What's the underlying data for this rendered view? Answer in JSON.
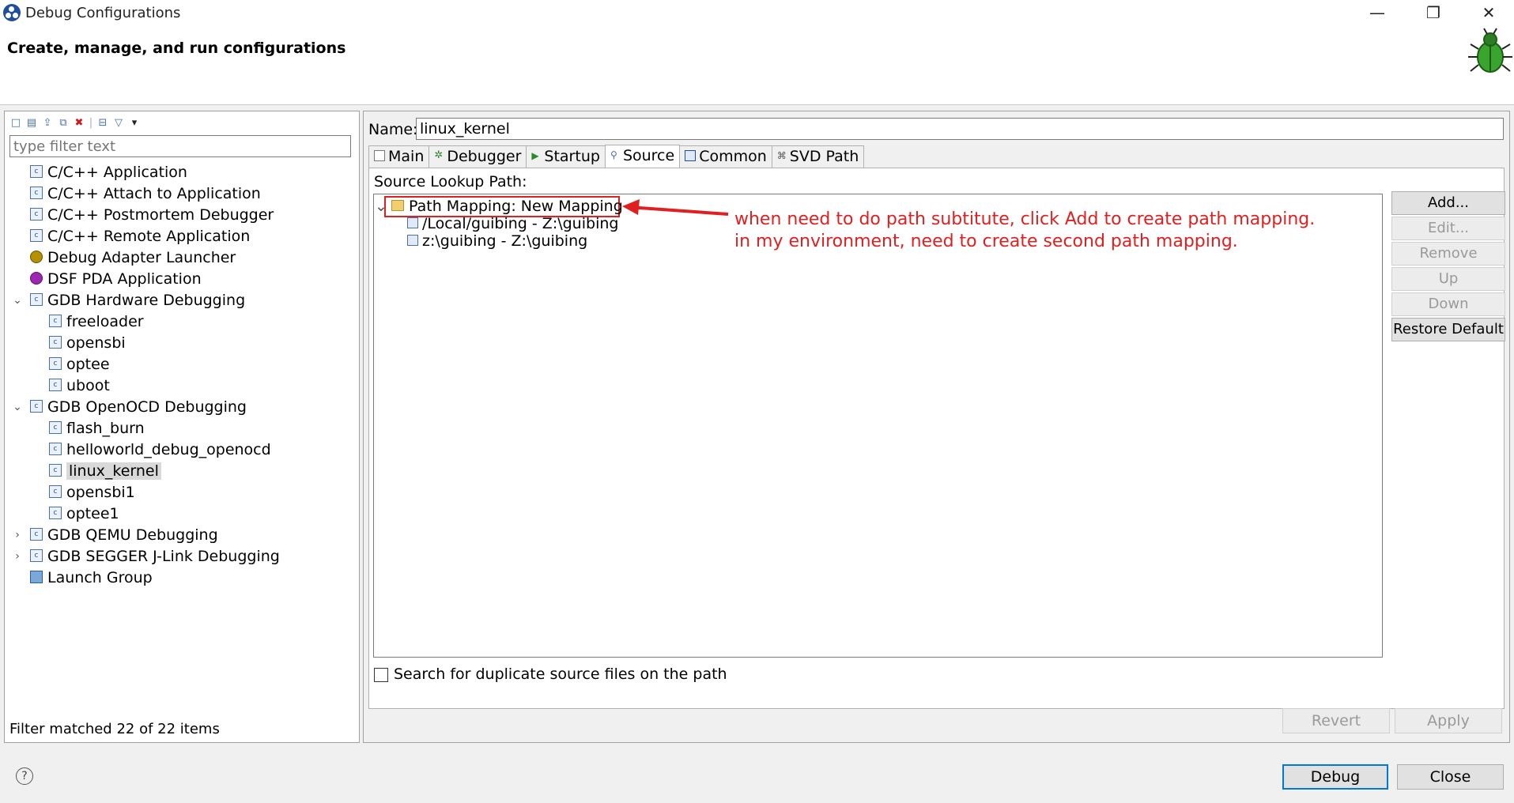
{
  "window": {
    "title": "Debug Configurations",
    "minimize": "—",
    "restore": "❐",
    "close": "✕"
  },
  "header": {
    "title": "Create, manage, and run configurations"
  },
  "left": {
    "filter_placeholder": "type filter text",
    "toolbar": [
      "new-config-icon",
      "new-prototype-icon",
      "export-icon",
      "duplicate-icon",
      "delete-icon",
      "collapse-all-icon",
      "filter-icon",
      "view-menu-icon"
    ],
    "tree": [
      {
        "label": "C/C++ Application",
        "level": 0,
        "arrow": "",
        "icon": "c"
      },
      {
        "label": "C/C++ Attach to Application",
        "level": 0,
        "arrow": "",
        "icon": "c"
      },
      {
        "label": "C/C++ Postmortem Debugger",
        "level": 0,
        "arrow": "",
        "icon": "c"
      },
      {
        "label": "C/C++ Remote Application",
        "level": 0,
        "arrow": "",
        "icon": "c"
      },
      {
        "label": "Debug Adapter Launcher",
        "level": 0,
        "arrow": "",
        "icon": "gear"
      },
      {
        "label": "DSF PDA Application",
        "level": 0,
        "arrow": "",
        "icon": "pda"
      },
      {
        "label": "GDB Hardware Debugging",
        "level": 0,
        "arrow": "expanded",
        "icon": "c"
      },
      {
        "label": "freeloader",
        "level": 1,
        "arrow": "",
        "icon": "c"
      },
      {
        "label": "opensbi",
        "level": 1,
        "arrow": "",
        "icon": "c"
      },
      {
        "label": "optee",
        "level": 1,
        "arrow": "",
        "icon": "c"
      },
      {
        "label": "uboot",
        "level": 1,
        "arrow": "",
        "icon": "c"
      },
      {
        "label": "GDB OpenOCD Debugging",
        "level": 0,
        "arrow": "expanded",
        "icon": "c"
      },
      {
        "label": "flash_burn",
        "level": 1,
        "arrow": "",
        "icon": "c"
      },
      {
        "label": "helloworld_debug_openocd",
        "level": 1,
        "arrow": "",
        "icon": "c"
      },
      {
        "label": "linux_kernel",
        "level": 1,
        "arrow": "",
        "icon": "c",
        "selected": true
      },
      {
        "label": "opensbi1",
        "level": 1,
        "arrow": "",
        "icon": "c"
      },
      {
        "label": "optee1",
        "level": 1,
        "arrow": "",
        "icon": "c"
      },
      {
        "label": "GDB QEMU Debugging",
        "level": 0,
        "arrow": "collapsed",
        "icon": "c"
      },
      {
        "label": "GDB SEGGER J-Link Debugging",
        "level": 0,
        "arrow": "collapsed",
        "icon": "c"
      },
      {
        "label": "Launch Group",
        "level": 0,
        "arrow": "",
        "icon": "launch"
      }
    ],
    "status": "Filter matched 22 of 22 items"
  },
  "right": {
    "name_label": "Name:",
    "name_value": "linux_kernel",
    "tabs": [
      {
        "label": "Main",
        "active": false
      },
      {
        "label": "Debugger",
        "active": false
      },
      {
        "label": "Startup",
        "active": false
      },
      {
        "label": "Source",
        "active": true
      },
      {
        "label": "Common",
        "active": false
      },
      {
        "label": "SVD Path",
        "active": false
      }
    ],
    "source_lookup_label": "Source Lookup Path:",
    "source_tree": {
      "root": "Path Mapping: New Mapping",
      "children": [
        "/Local/guibing - Z:\\guibing",
        "z:\\guibing - Z:\\guibing"
      ]
    },
    "annotation": [
      "when need to do path subtitute, click Add to create path mapping.",
      "in my environment, need to create second path mapping."
    ],
    "side_buttons": [
      {
        "label": "Add...",
        "enabled": true
      },
      {
        "label": "Edit...",
        "enabled": false
      },
      {
        "label": "Remove",
        "enabled": false
      },
      {
        "label": "Up",
        "enabled": false
      },
      {
        "label": "Down",
        "enabled": false
      },
      {
        "label": "Restore Default",
        "enabled": true
      }
    ],
    "duplicate_checkbox_label": "Search for duplicate source files on the path",
    "revert_label": "Revert",
    "apply_label": "Apply"
  },
  "footer": {
    "debug_label": "Debug",
    "close_label": "Close",
    "help": "?"
  },
  "colors": {
    "annotation": "#e02020",
    "primary_border": "#0078d7"
  }
}
